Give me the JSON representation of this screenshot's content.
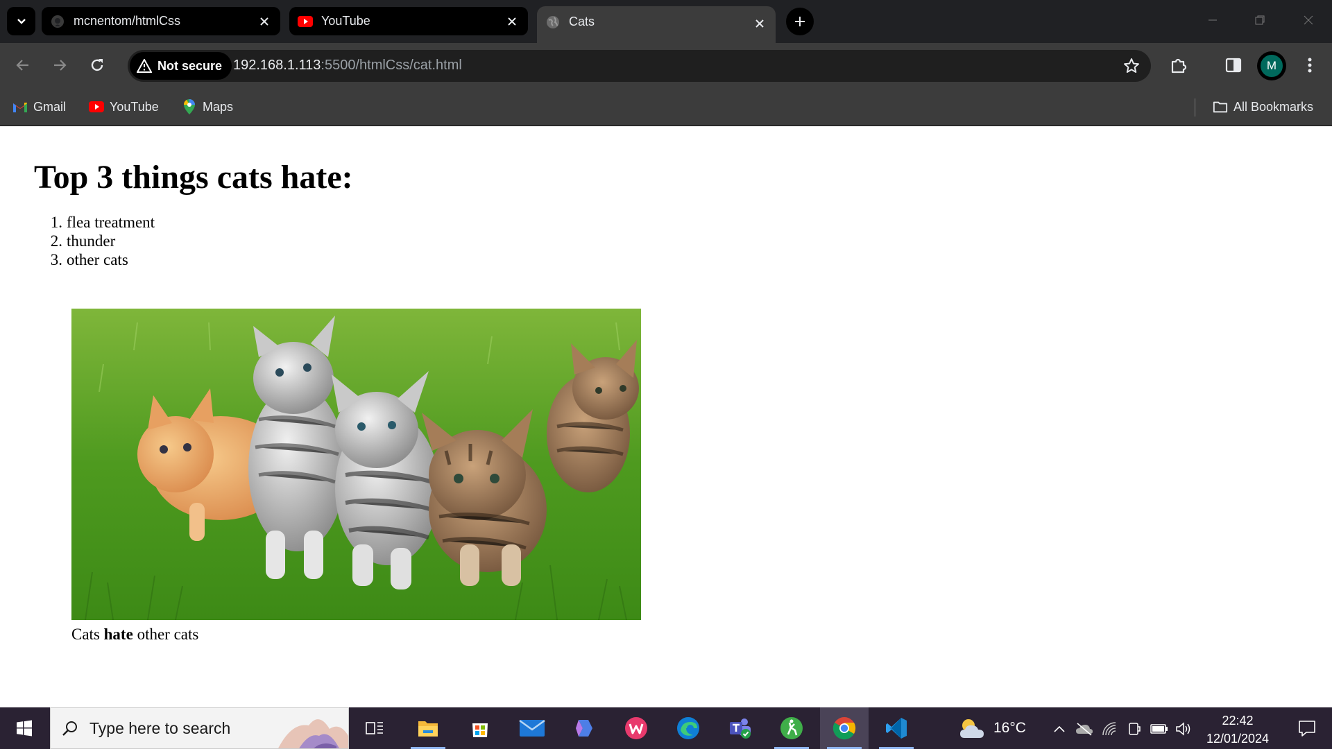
{
  "browser": {
    "tabs": [
      {
        "title": "mcnentom/htmlCss",
        "icon": "github-icon"
      },
      {
        "title": "YouTube",
        "icon": "youtube-icon"
      },
      {
        "title": "Cats",
        "icon": "globe-icon",
        "active": true
      }
    ],
    "security_label": "Not secure",
    "url_host": "192.168.1.113",
    "url_rest": ":5500/htmlCss/cat.html",
    "avatar_letter": "M",
    "bookmarks": [
      {
        "label": "Gmail",
        "icon": "gmail-icon"
      },
      {
        "label": "YouTube",
        "icon": "youtube-icon"
      },
      {
        "label": "Maps",
        "icon": "maps-icon"
      }
    ],
    "all_bookmarks_label": "All Bookmarks"
  },
  "page": {
    "title": "Top 3 things cats hate:",
    "list": [
      {
        "num": "1.",
        "text": "flea treatment"
      },
      {
        "num": "2.",
        "text": "thunder"
      },
      {
        "num": "3.",
        "text": "other cats"
      }
    ],
    "figure": {
      "caption_before": "Cats ",
      "caption_bold": "hate",
      "caption_after": " other cats"
    }
  },
  "taskbar": {
    "search_placeholder": "Type here to search",
    "weather_temp": "16°C",
    "time": "22:42",
    "date": "12/01/2024",
    "apps": [
      "task-view-icon",
      "file-explorer-icon",
      "microsoft-store-icon",
      "mail-icon",
      "copilot-icon",
      "wps-office-icon",
      "edge-icon",
      "teams-icon",
      "greenshot-icon",
      "chrome-icon",
      "vscode-icon"
    ]
  },
  "colors": {
    "chrome_dark": "#202124",
    "toolbar": "#3c3c3c",
    "taskbar": "#2a2233",
    "avatar": "#00695c"
  }
}
